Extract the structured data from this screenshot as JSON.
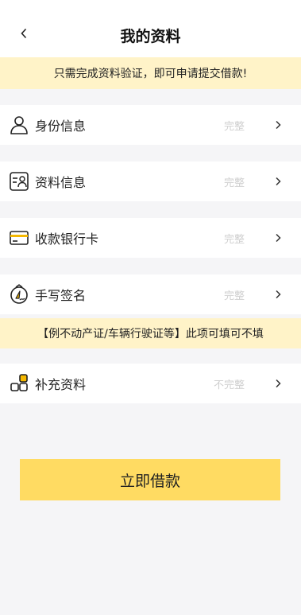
{
  "header": {
    "title": "我的资料",
    "back_icon": "chevron-left-icon"
  },
  "notice": "只需完成资料验证，即可申请提交借款!",
  "items": [
    {
      "label": "身份信息",
      "status": "完整",
      "icon": "person-icon"
    },
    {
      "label": "资料信息",
      "status": "完整",
      "icon": "id-card-icon"
    },
    {
      "label": "收款银行卡",
      "status": "完整",
      "icon": "bank-card-icon"
    },
    {
      "label": "手写签名",
      "status": "完整",
      "icon": "signature-icon"
    }
  ],
  "supplement_note": "【例不动产证/车辆行驶证等】此项可填可不填",
  "supplement": {
    "label": "补充资料",
    "status": "不完整",
    "icon": "grid-blocks-icon"
  },
  "submit_label": "立即借款",
  "colors": {
    "accent": "#ffdb62",
    "notice_bg": "#fff3c8",
    "background": "#f5f5f7"
  }
}
